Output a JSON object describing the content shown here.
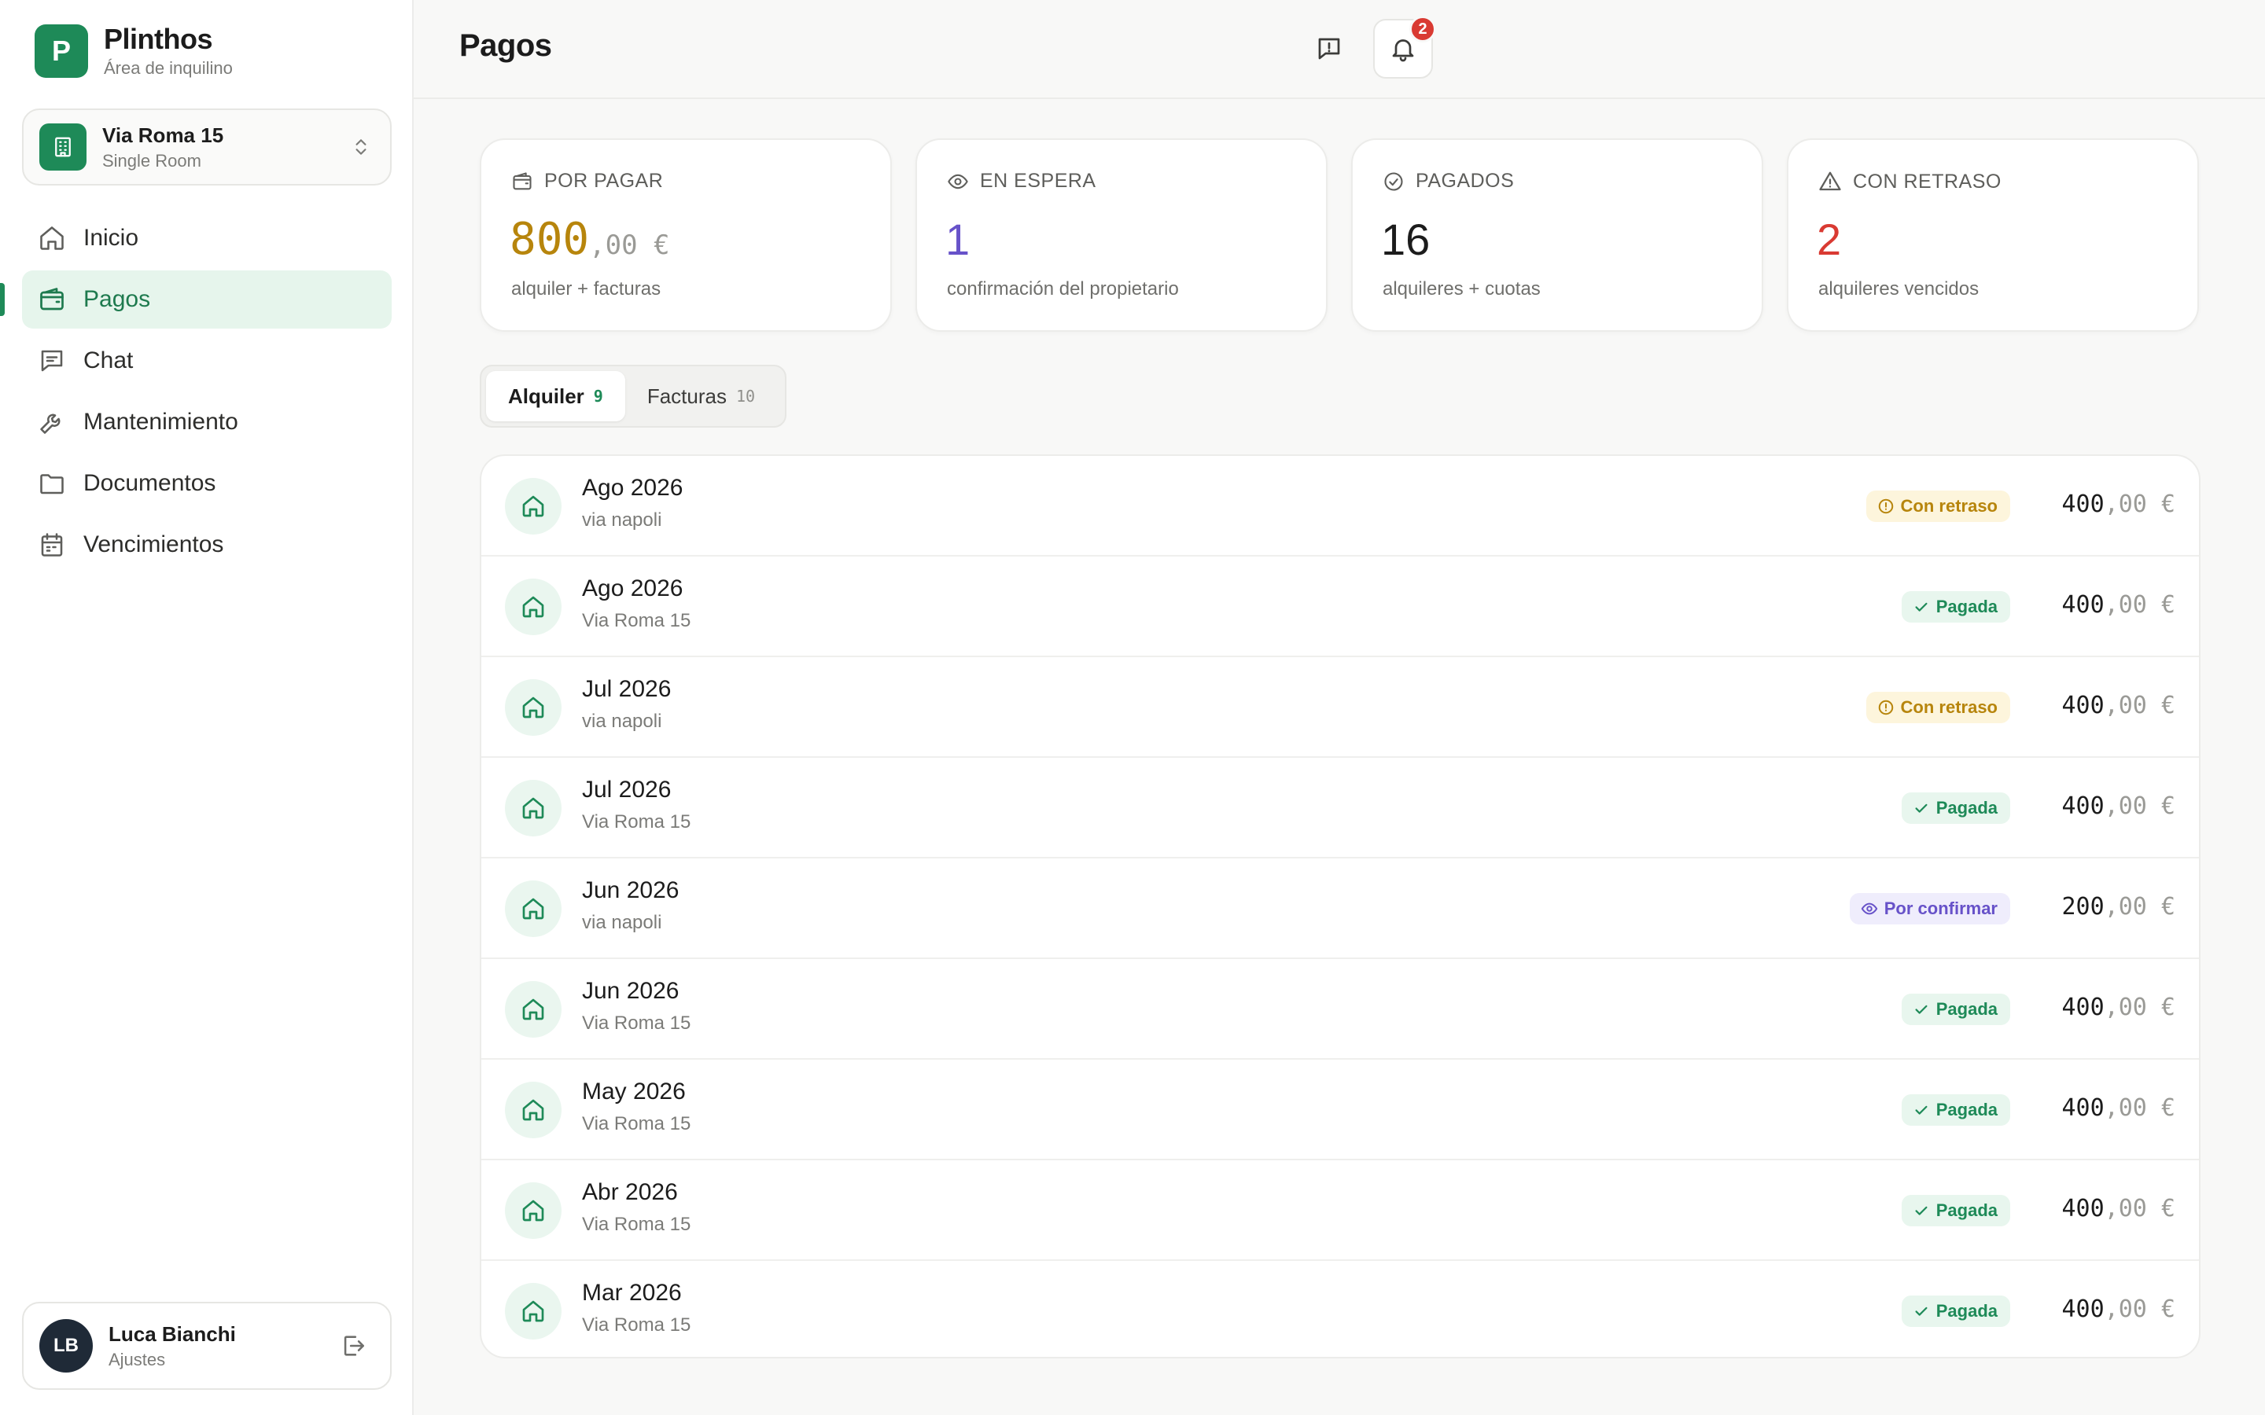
{
  "brand": {
    "initial": "P",
    "name": "Plinthos",
    "subtitle": "Área de inquilino"
  },
  "property": {
    "name": "Via Roma 15",
    "type": "Single Room"
  },
  "nav": [
    {
      "label": "Inicio",
      "icon": "home-icon",
      "active": false
    },
    {
      "label": "Pagos",
      "icon": "wallet-icon",
      "active": true
    },
    {
      "label": "Chat",
      "icon": "chat-icon",
      "active": false
    },
    {
      "label": "Mantenimiento",
      "icon": "wrench-icon",
      "active": false
    },
    {
      "label": "Documentos",
      "icon": "folder-icon",
      "active": false
    },
    {
      "label": "Vencimientos",
      "icon": "calendar-icon",
      "active": false
    }
  ],
  "user": {
    "initials": "LB",
    "name": "Luca Bianchi",
    "subtitle": "Ajustes"
  },
  "header": {
    "title": "Pagos",
    "notification_count": "2"
  },
  "stats": [
    {
      "label": "POR PAGAR",
      "value": "800",
      "decimals": ",00 €",
      "sub": "alquiler + facturas",
      "color": "#b7850c",
      "icon": "wallet-icon"
    },
    {
      "label": "EN ESPERA",
      "value": "1",
      "decimals": "",
      "sub": "confirmación del propietario",
      "color": "#6752c9",
      "icon": "eye-icon"
    },
    {
      "label": "PAGADOS",
      "value": "16",
      "decimals": "",
      "sub": "alquileres + cuotas",
      "color": "#1c1c1c",
      "icon": "check-circle-icon"
    },
    {
      "label": "CON RETRASO",
      "value": "2",
      "decimals": "",
      "sub": "alquileres vencidos",
      "color": "#d93a32",
      "icon": "warning-icon"
    }
  ],
  "tabs": [
    {
      "label": "Alquiler",
      "count": "9",
      "active": true
    },
    {
      "label": "Facturas",
      "count": "10",
      "active": false
    }
  ],
  "payments": [
    {
      "period": "Ago 2026",
      "property": "via napoli",
      "status": "Con retraso",
      "status_type": "late",
      "amount": "400",
      "decimals": ",00 €"
    },
    {
      "period": "Ago 2026",
      "property": "Via Roma 15",
      "status": "Pagada",
      "status_type": "paid",
      "amount": "400",
      "decimals": ",00 €"
    },
    {
      "period": "Jul 2026",
      "property": "via napoli",
      "status": "Con retraso",
      "status_type": "late",
      "amount": "400",
      "decimals": ",00 €"
    },
    {
      "period": "Jul 2026",
      "property": "Via Roma 15",
      "status": "Pagada",
      "status_type": "paid",
      "amount": "400",
      "decimals": ",00 €"
    },
    {
      "period": "Jun 2026",
      "property": "via napoli",
      "status": "Por confirmar",
      "status_type": "pending",
      "amount": "200",
      "decimals": ",00 €"
    },
    {
      "period": "Jun 2026",
      "property": "Via Roma 15",
      "status": "Pagada",
      "status_type": "paid",
      "amount": "400",
      "decimals": ",00 €"
    },
    {
      "period": "May 2026",
      "property": "Via Roma 15",
      "status": "Pagada",
      "status_type": "paid",
      "amount": "400",
      "decimals": ",00 €"
    },
    {
      "period": "Abr 2026",
      "property": "Via Roma 15",
      "status": "Pagada",
      "status_type": "paid",
      "amount": "400",
      "decimals": ",00 €"
    },
    {
      "period": "Mar 2026",
      "property": "Via Roma 15",
      "status": "Pagada",
      "status_type": "paid",
      "amount": "400",
      "decimals": ",00 €"
    }
  ]
}
